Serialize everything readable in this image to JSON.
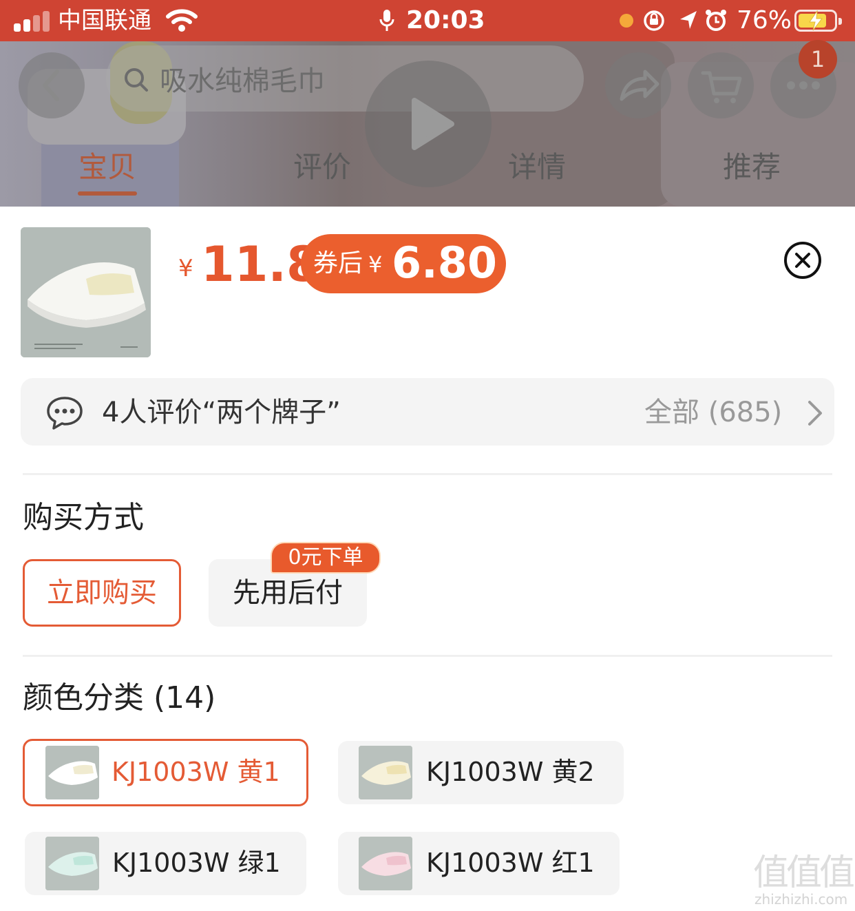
{
  "status_bar": {
    "carrier": "中国联通",
    "time": "20:03",
    "battery_percent": "76%"
  },
  "header": {
    "search_text": "吸水纯棉毛巾",
    "cart_badge": "1",
    "tabs": [
      {
        "label": "宝贝",
        "active": true
      },
      {
        "label": "评价",
        "active": false
      },
      {
        "label": "详情",
        "active": false
      },
      {
        "label": "推荐",
        "active": false
      }
    ]
  },
  "product": {
    "currency_symbol": "¥",
    "price": "11.8",
    "coupon_label": "券后",
    "coupon_currency": "¥",
    "coupon_price": "6.80"
  },
  "review": {
    "summary": "4人评价“两个牌子”",
    "all_label": "全部 (685)"
  },
  "purchase": {
    "title": "购买方式",
    "buy_now": "立即购买",
    "pay_later": "先用后付",
    "pay_later_badge": "0元下单"
  },
  "color": {
    "title": "颜色分类 (14)",
    "options": [
      {
        "label": "KJ1003W 黄1",
        "selected": true,
        "swatch": "#ffffff"
      },
      {
        "label": "KJ1003W 黄2",
        "selected": false,
        "swatch": "#f4ecd2"
      },
      {
        "label": "KJ1003W 绿1",
        "selected": false,
        "swatch": "#d9efe8"
      },
      {
        "label": "KJ1003W 红1",
        "selected": false,
        "swatch": "#f4d4dc"
      }
    ]
  },
  "colors": {
    "status_bar": "#cf4433",
    "accent": "#e45b35",
    "price": "#e5572e"
  },
  "watermark": {
    "cn": "值值值",
    "en": "zhizhizhi.com"
  }
}
